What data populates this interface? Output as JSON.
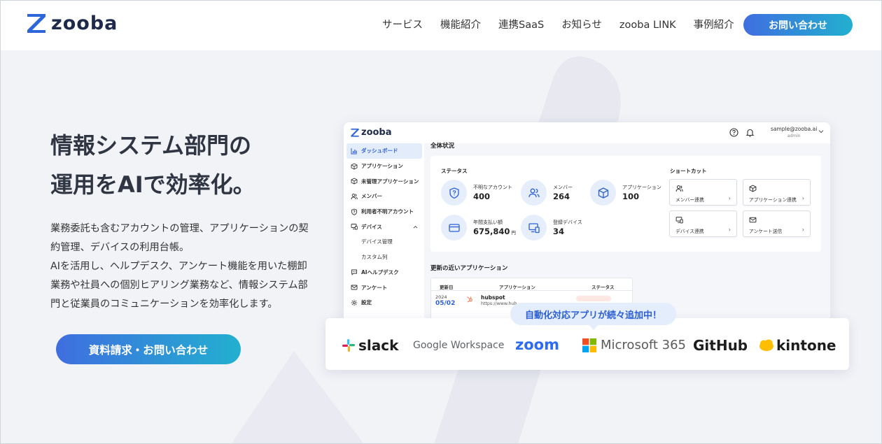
{
  "header": {
    "logo_text": "zooba",
    "nav": [
      "サービス",
      "機能紹介",
      "連携SaaS",
      "お知らせ",
      "zooba LINK",
      "事例紹介"
    ],
    "cta": "お問い合わせ",
    "accent_gradient": [
      "#3f6ee0",
      "#22b0cf"
    ]
  },
  "hero": {
    "title_lines": [
      "情報システム部門の",
      "運用をAIで効率化。"
    ],
    "description_lines": [
      "業務委託も含むアカウントの管理、アプリケーションの契",
      "約管理、デバイスの利用台帳。",
      "AIを活用し、ヘルプデスク、アンケート機能を用いた棚卸",
      "業務や社員への個別ヒアリング業務など、情報システム部",
      "門と従業員のコミュニケーションを効率化します。"
    ],
    "cta": "資料請求・お問い合わせ"
  },
  "app": {
    "logo_text": "zooba",
    "user_email": "sample@zooba.ai",
    "user_role": "admin",
    "sidebar": [
      {
        "label": "ダッシュボード",
        "icon": "chart-bar-icon"
      },
      {
        "label": "アプリケーション",
        "icon": "cube-icon"
      },
      {
        "label": "未管理アプリケーション",
        "icon": "cube-icon"
      },
      {
        "label": "メンバー",
        "icon": "users-icon"
      },
      {
        "label": "利用者不明アカウント",
        "icon": "shield-icon"
      },
      {
        "label": "デバイス",
        "icon": "devices-icon"
      },
      {
        "label": "デバイス管理",
        "icon": ""
      },
      {
        "label": "カスタム列",
        "icon": ""
      },
      {
        "label": "AIヘルプデスク",
        "icon": "chat-icon"
      },
      {
        "label": "アンケート",
        "icon": "mail-icon"
      },
      {
        "label": "設定",
        "icon": "gear-icon"
      }
    ],
    "overview_title": "全体状況",
    "status_label": "ステータス",
    "stats": [
      {
        "label": "不明なアカウント",
        "value": "400",
        "unit": "",
        "icon": "shield-question-icon"
      },
      {
        "label": "メンバー",
        "value": "264",
        "unit": "",
        "icon": "users-icon"
      },
      {
        "label": "アプリケーション",
        "value": "100",
        "unit": "",
        "icon": "cube-icon"
      },
      {
        "label": "年間支払い額",
        "value": "675,840",
        "unit": "円",
        "icon": "card-icon"
      },
      {
        "label": "登録デバイス",
        "value": "34",
        "unit": "",
        "icon": "devices-icon"
      }
    ],
    "shortcut_label": "ショートカット",
    "shortcuts": [
      {
        "label": "メンバー連携",
        "icon": "users-icon"
      },
      {
        "label": "アプリケーション連携",
        "icon": "cube-icon"
      },
      {
        "label": "デバイス連携",
        "icon": "devices-icon"
      },
      {
        "label": "アンケート送信",
        "icon": "mail-icon"
      }
    ],
    "recent_title": "更新の近いアプリケーション",
    "table_headers": [
      "更新日",
      "アプリケーション",
      "ステータス"
    ],
    "table_rows": [
      {
        "year": "2024",
        "date": "05/02",
        "name": "hubspot",
        "url": "https://www.hub"
      }
    ]
  },
  "integrations": {
    "bubble": "自動化対応アプリが続々追加中！",
    "logos": [
      "slack",
      "Google Workspace",
      "zoom",
      "Microsoft 365",
      "GitHub",
      "kintone"
    ]
  }
}
